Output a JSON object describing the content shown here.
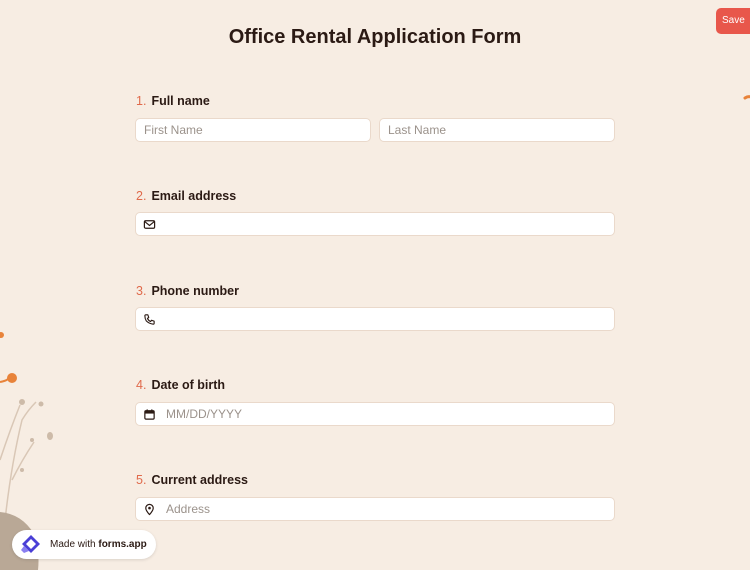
{
  "header": {
    "title": "Office Rental Application Form",
    "save_label": "Save"
  },
  "questions": [
    {
      "number": "1.",
      "label": "Full name",
      "fields": [
        {
          "placeholder": "First Name",
          "value": ""
        },
        {
          "placeholder": "Last Name",
          "value": ""
        }
      ]
    },
    {
      "number": "2.",
      "label": "Email address",
      "fields": [
        {
          "placeholder": "",
          "value": "",
          "icon": "envelope-icon"
        }
      ]
    },
    {
      "number": "3.",
      "label": "Phone number",
      "fields": [
        {
          "placeholder": "",
          "value": "",
          "icon": "phone-icon"
        }
      ]
    },
    {
      "number": "4.",
      "label": "Date of birth",
      "fields": [
        {
          "placeholder": "MM/DD/YYYY",
          "value": "",
          "icon": "calendar-icon"
        }
      ]
    },
    {
      "number": "5.",
      "label": "Current address",
      "fields": [
        {
          "placeholder": "Address",
          "value": "",
          "icon": "location-pin-icon"
        }
      ]
    }
  ],
  "badge": {
    "prefix": "Made with",
    "brand": "forms.app",
    "icon": "forms-app-logo-icon"
  },
  "colors": {
    "background": "#f7ede3",
    "accent": "#e8574b",
    "number": "#e06a4b",
    "field_border": "#ead9cb"
  }
}
